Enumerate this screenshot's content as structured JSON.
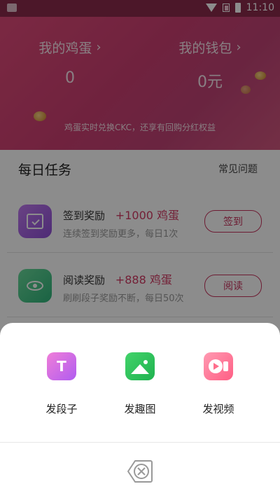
{
  "status_bar": {
    "time": "11:10"
  },
  "header": {
    "eggs": {
      "label": "我的鸡蛋",
      "value": "0"
    },
    "wallet": {
      "label": "我的钱包",
      "value": "0元"
    },
    "note": "鸡蛋实时兑换CKC，还享有回购分红权益"
  },
  "tasks": {
    "title": "每日任务",
    "faq": "常见问题",
    "items": [
      {
        "name": "签到奖励",
        "reward": "+1000 鸡蛋",
        "desc": "连续签到奖励更多，每日1次",
        "button": "签到",
        "icon": "calendar-check-icon"
      },
      {
        "name": "阅读奖励",
        "reward": "+888 鸡蛋",
        "desc": "刷刷段子奖励不断，每日50次",
        "button": "阅读",
        "icon": "eye-icon"
      }
    ]
  },
  "sheet": {
    "actions": [
      {
        "label": "发段子",
        "icon": "text-post-icon"
      },
      {
        "label": "发趣图",
        "icon": "image-post-icon"
      },
      {
        "label": "发视频",
        "icon": "video-post-icon"
      }
    ],
    "close_icon": "close-icon"
  },
  "colors": {
    "header_gradient_start": "#e04a79",
    "accent": "#c7345e",
    "reward": "#d23a63",
    "overlay": "rgba(0,0,0,0.45)"
  }
}
